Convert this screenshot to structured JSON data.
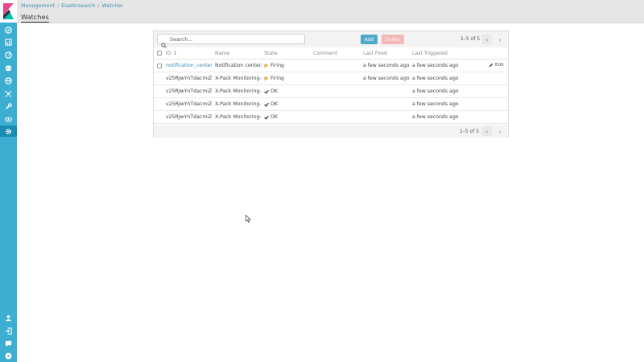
{
  "breadcrumb": {
    "items": [
      "Management",
      "Elasticsearch",
      "Watcher"
    ],
    "separator": "/"
  },
  "page": {
    "title": "Watches"
  },
  "search": {
    "placeholder": "Search..."
  },
  "toolbar": {
    "add_label": "Add",
    "delete_label": "Delete"
  },
  "pagination": {
    "text": "1–5 of 5",
    "prev": "‹",
    "next": "›"
  },
  "table": {
    "columns": {
      "id": "ID",
      "name": "Name",
      "state": "State",
      "comment": "Comment",
      "last_fired": "Last Fired",
      "last_triggered": "Last Triggered"
    },
    "sort_indicator": "↕",
    "rows": [
      {
        "id": "notification_center...",
        "name": "Notification center...",
        "state": "Firing",
        "state_icon": "flag-icon",
        "comment": "",
        "last_fired": "a few seconds ago",
        "last_triggered": "a few seconds ago",
        "edit": "Edit"
      },
      {
        "id": "v25RJwYnTdacmiZ...",
        "name": "X-Pack Monitoring-...",
        "state": "Firing",
        "state_icon": "flag-icon",
        "comment": "",
        "last_fired": "a few seconds ago",
        "last_triggered": "a few seconds ago",
        "edit": ""
      },
      {
        "id": "v25RJwYnTdacmiZ...",
        "name": "X-Pack Monitoring-...",
        "state": "OK",
        "state_icon": "check-icon",
        "comment": "",
        "last_fired": "",
        "last_triggered": "a few seconds ago",
        "edit": ""
      },
      {
        "id": "v25RJwYnTdacmiZ...",
        "name": "X-Pack Monitoring-...",
        "state": "OK",
        "state_icon": "check-icon",
        "comment": "",
        "last_fired": "",
        "last_triggered": "a few seconds ago",
        "edit": ""
      },
      {
        "id": "v25RJwYnTdacmiZ...",
        "name": "X-Pack Monitoring-...",
        "state": "OK",
        "state_icon": "check-icon",
        "comment": "",
        "last_fired": "",
        "last_triggered": "a few seconds ago",
        "edit": ""
      }
    ]
  },
  "sidebar": {
    "logo": "kibana-logo",
    "items": [
      "discover-icon",
      "visualize-icon",
      "dashboard-icon",
      "timelion-icon",
      "apm-icon",
      "graph-icon",
      "devtools-icon",
      "monitoring-icon",
      "management-icon"
    ],
    "bottom_items": [
      "user-icon",
      "logout-icon",
      "help-icon",
      "collapse-icon"
    ]
  },
  "colors": {
    "sidebar": "#3caed2",
    "sidebar_active": "#1a8bb3",
    "link": "#3c8fb5",
    "add_button": "#4fa8c7",
    "delete_button": "#f2b7b7",
    "firing": "#e8a838",
    "ok": "#333333"
  }
}
